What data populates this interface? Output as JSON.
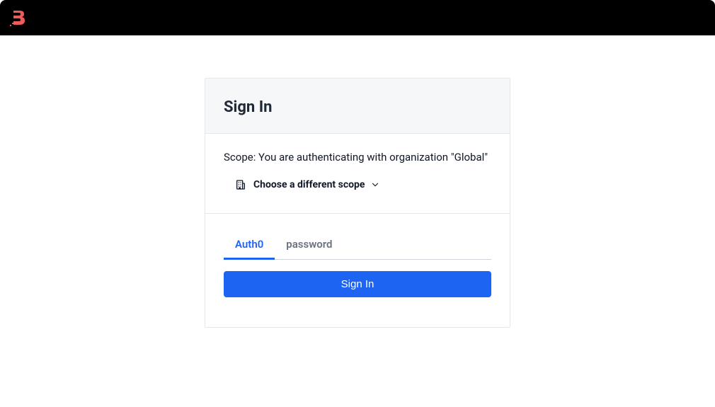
{
  "header": {
    "title": "Sign In"
  },
  "scope": {
    "text": "Scope: You are authenticating with organization \"Global\"",
    "link_label": "Choose a different scope"
  },
  "tabs": [
    {
      "label": "Auth0",
      "active": true
    },
    {
      "label": "password",
      "active": false
    }
  ],
  "action": {
    "signin_label": "Sign In"
  }
}
